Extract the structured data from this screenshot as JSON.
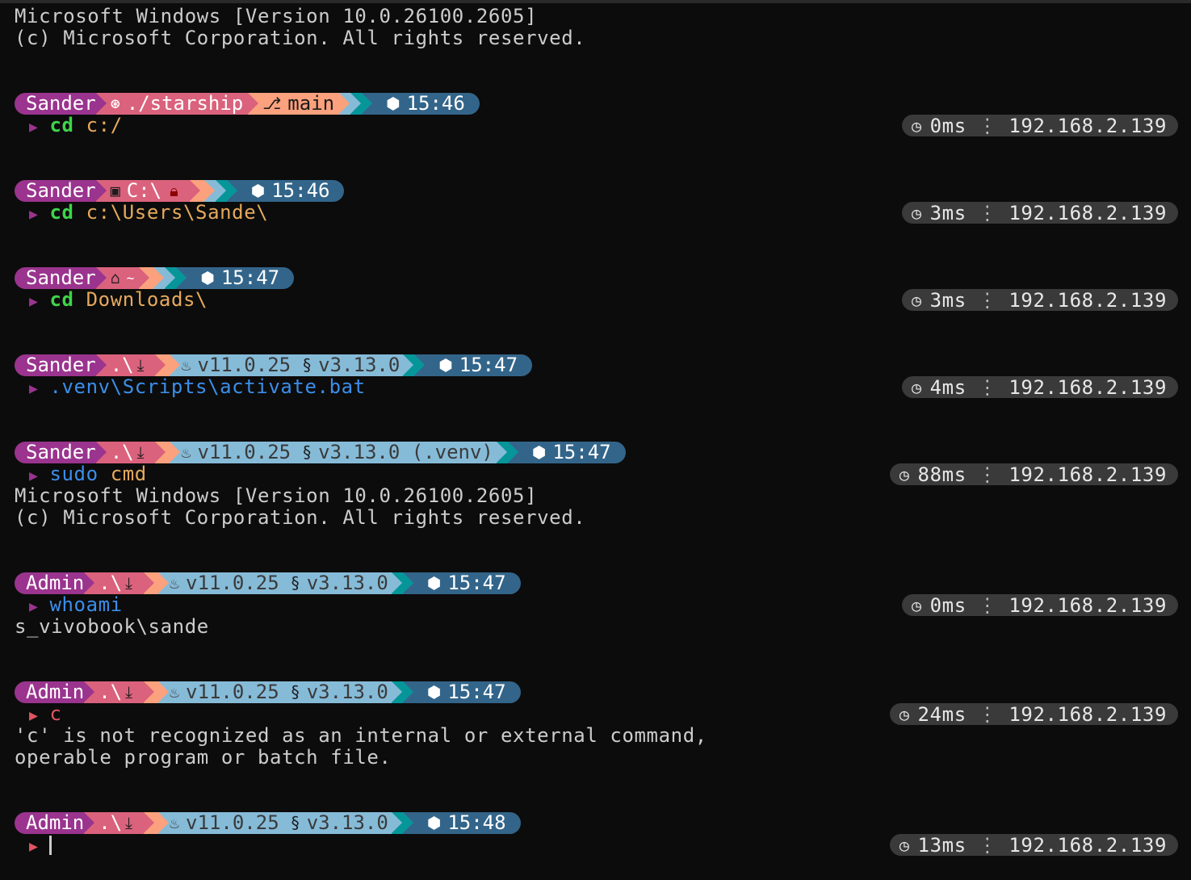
{
  "header": {
    "line1": "Microsoft Windows [Version 10.0.26100.2605]",
    "line2": "(c) Microsoft Corporation. All rights reserved."
  },
  "icons": {
    "github": "github-icon",
    "branch": "git-branch-icon",
    "drive": "drive-icon",
    "lock": "lock-icon",
    "home": "home-icon",
    "download": "download-icon",
    "java": "java-icon",
    "python": "python-icon",
    "shield": "shield-icon",
    "clock": "clock-icon",
    "caret": "prompt-caret-icon"
  },
  "colors": {
    "user_segment": "#9a348e",
    "path_segment": "#da627d",
    "git_segment": "#fca17d",
    "lang_segment": "#86bbd8",
    "teal_segment": "#06969a",
    "time_segment": "#33658a",
    "right_badge": "#3a3a3a",
    "command_green": "#3fd44a",
    "argument_orange": "#e6a95c",
    "command_blue": "#3b8eea",
    "command_red": "#e05561"
  },
  "blocks": [
    {
      "user": "Sander",
      "path": "./starship",
      "git_branch": "main",
      "time": "15:46",
      "command": "cd",
      "argument": " c:/",
      "duration": "0ms",
      "ip": "192.168.2.139"
    },
    {
      "user": "Sander",
      "path": "C:\\",
      "time": "15:46",
      "command": "cd",
      "argument": " c:\\Users\\Sande\\",
      "duration": "3ms",
      "ip": "192.168.2.139"
    },
    {
      "user": "Sander",
      "path": "~",
      "time": "15:47",
      "command": "cd",
      "argument": " Downloads\\",
      "duration": "3ms",
      "ip": "192.168.2.139"
    },
    {
      "user": "Sander",
      "path": ".\\",
      "java": "v11.0.25",
      "python": "v3.13.0",
      "time": "15:47",
      "command": ".venv\\Scripts\\activate.bat",
      "duration": "4ms",
      "ip": "192.168.2.139"
    },
    {
      "user": "Sander",
      "path": ".\\",
      "java": "v11.0.25",
      "python": "v3.13.0 (.venv)",
      "time": "15:47",
      "command": "sudo",
      "argument": " cmd",
      "duration": "88ms",
      "ip": "192.168.2.139",
      "output": [
        "Microsoft Windows [Version 10.0.26100.2605]",
        "(c) Microsoft Corporation. All rights reserved."
      ]
    },
    {
      "user": "Admin",
      "path": ".\\",
      "java": "v11.0.25",
      "python": "v3.13.0",
      "time": "15:47",
      "command": "whoami",
      "duration": "0ms",
      "ip": "192.168.2.139",
      "output": [
        "s_vivobook\\sande"
      ]
    },
    {
      "user": "Admin",
      "path": ".\\",
      "java": "v11.0.25",
      "python": "v3.13.0",
      "time": "15:47",
      "command": "c",
      "duration": "24ms",
      "ip": "192.168.2.139",
      "output": [
        "'c' is not recognized as an internal or external command,",
        "operable program or batch file."
      ]
    },
    {
      "user": "Admin",
      "path": ".\\",
      "java": "v11.0.25",
      "python": "v3.13.0",
      "time": "15:48",
      "command": "",
      "duration": "13ms",
      "ip": "192.168.2.139"
    }
  ]
}
